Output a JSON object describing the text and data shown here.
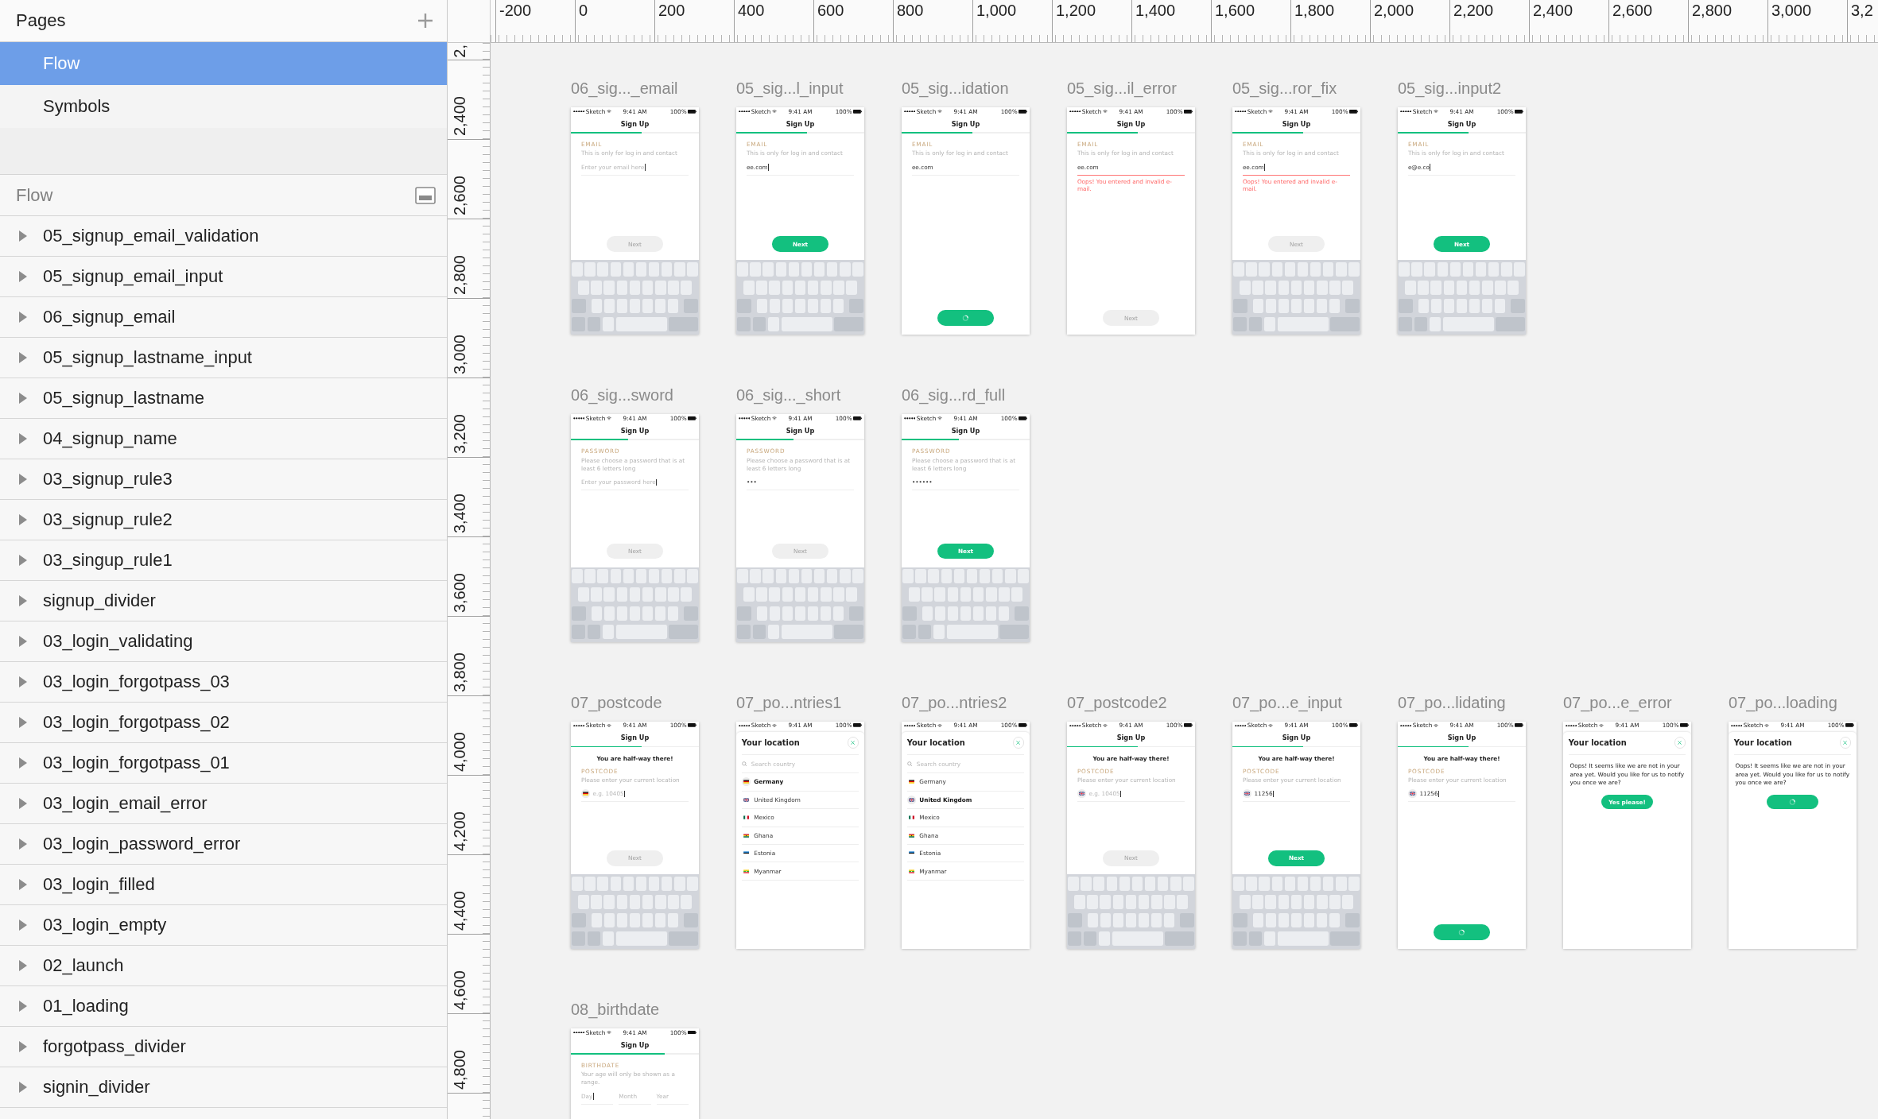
{
  "sidebar": {
    "pages_header": {
      "title": "Pages"
    },
    "pages": [
      {
        "label": "Flow",
        "selected": true
      },
      {
        "label": "Symbols",
        "selected": false
      }
    ],
    "layers_header": {
      "title": "Flow"
    },
    "layers": [
      {
        "name": "05_signup_email_validation",
        "expanded": false
      },
      {
        "name": "05_signup_email_input",
        "expanded": false
      },
      {
        "name": "06_signup_email",
        "expanded": false
      },
      {
        "name": "05_signup_lastname_input",
        "expanded": false
      },
      {
        "name": "05_signup_lastname",
        "expanded": false
      },
      {
        "name": "04_signup_name",
        "expanded": false
      },
      {
        "name": "03_signup_rule3",
        "expanded": false
      },
      {
        "name": "03_signup_rule2",
        "expanded": false
      },
      {
        "name": "03_singup_rule1",
        "expanded": false
      },
      {
        "name": "signup_divider",
        "expanded": false
      },
      {
        "name": "03_login_validating",
        "expanded": false
      },
      {
        "name": "03_login_forgotpass_03",
        "expanded": false
      },
      {
        "name": "03_login_forgotpass_02",
        "expanded": false
      },
      {
        "name": "03_login_forgotpass_01",
        "expanded": false
      },
      {
        "name": "03_login_email_error",
        "expanded": false
      },
      {
        "name": "03_login_password_error",
        "expanded": false
      },
      {
        "name": "03_login_filled",
        "expanded": false
      },
      {
        "name": "03_login_empty",
        "expanded": false
      },
      {
        "name": "02_launch",
        "expanded": false
      },
      {
        "name": "01_loading",
        "expanded": false
      },
      {
        "name": "forgotpass_divider",
        "expanded": false
      },
      {
        "name": "signin_divider",
        "expanded": false
      }
    ]
  },
  "rulers": {
    "horizontal": [
      "-200",
      "0",
      "200",
      "400",
      "600",
      "800",
      "1,000",
      "1,200",
      "1,400",
      "1,600",
      "1,800",
      "2,000",
      "2,200",
      "2,400",
      "2,600",
      "2,800",
      "3,000",
      "3,2"
    ],
    "vertical": [
      "2,",
      "2,400",
      "2,600",
      "2,800",
      "3,000",
      "3,200",
      "3,400",
      "3,600",
      "3,800",
      "4,000",
      "4,200",
      "4,400",
      "4,600",
      "4,800"
    ]
  },
  "canvas": {
    "rows": [
      {
        "artboards": [
          {
            "title": "06_sig..._email",
            "status_bar": {
              "carrier": "Sketch",
              "time": "9:41 AM",
              "battery": "100%"
            },
            "screen": {
              "kind": "signup",
              "title": "Sign Up",
              "progress": {
                "level": 0.55
              },
              "label": "EMAIL",
              "hint": "This is only for log in and contact",
              "fields": [
                {
                  "placeholder": "Enter your email here",
                  "cursor": true,
                  "error": false
                }
              ],
              "button": {
                "label": "Next",
                "enabled": false,
                "loading": false
              },
              "keyboard": true
            }
          },
          {
            "title": "05_sig...l_input",
            "status_bar": {
              "carrier": "Sketch",
              "time": "9:41 AM",
              "battery": "100%"
            },
            "screen": {
              "kind": "signup",
              "title": "Sign Up",
              "progress": {
                "level": 0.55
              },
              "label": "EMAIL",
              "hint": "This is only for log in and contact",
              "fields": [
                {
                  "value": "ee.com",
                  "cursor": true,
                  "error": false
                }
              ],
              "button": {
                "label": "Next",
                "enabled": true,
                "loading": false
              },
              "keyboard": true
            }
          },
          {
            "title": "05_sig...idation",
            "status_bar": {
              "carrier": "Sketch",
              "time": "9:41 AM",
              "battery": "100%"
            },
            "screen": {
              "kind": "signup",
              "title": "Sign Up",
              "progress": {
                "level": 0.55
              },
              "label": "EMAIL",
              "hint": "This is only for log in and contact",
              "fields": [
                {
                  "value": "ee.com",
                  "cursor": false,
                  "error": false
                }
              ],
              "button": {
                "enabled": true,
                "loading": true
              },
              "keyboard": false
            }
          },
          {
            "title": "05_sig...il_error",
            "status_bar": {
              "carrier": "Sketch",
              "time": "9:41 AM",
              "battery": "100%"
            },
            "screen": {
              "kind": "signup",
              "title": "Sign Up",
              "progress": {
                "level": 0.55
              },
              "label": "EMAIL",
              "hint": "This is only for log in and contact",
              "fields": [
                {
                  "value": "ee.com",
                  "cursor": false,
                  "error": true
                }
              ],
              "error_text": "Oops! You entered and invalid e-mail.",
              "button": {
                "label": "Next",
                "enabled": false,
                "loading": false
              },
              "keyboard": false
            }
          },
          {
            "title": "05_sig...ror_fix",
            "status_bar": {
              "carrier": "Sketch",
              "time": "9:41 AM",
              "battery": "100%"
            },
            "screen": {
              "kind": "signup",
              "title": "Sign Up",
              "progress": {
                "level": 0.55
              },
              "label": "EMAIL",
              "hint": "This is only for log in and contact",
              "fields": [
                {
                  "value": "ee.com",
                  "cursor": true,
                  "error": true
                }
              ],
              "error_text": "Oops! You entered and invalid e-mail.",
              "button": {
                "label": "Next",
                "enabled": false,
                "loading": false
              },
              "keyboard": true
            }
          },
          {
            "title": "05_sig...input2",
            "status_bar": {
              "carrier": "Sketch",
              "time": "9:41 AM",
              "battery": "100%"
            },
            "screen": {
              "kind": "signup",
              "title": "Sign Up",
              "progress": {
                "level": 0.55
              },
              "label": "EMAIL",
              "hint": "This is only for log in and contact",
              "fields": [
                {
                  "value": "e@e.co",
                  "cursor": true,
                  "error": false
                }
              ],
              "button": {
                "label": "Next",
                "enabled": true,
                "loading": false
              },
              "keyboard": true
            }
          }
        ]
      },
      {
        "artboards": [
          {
            "title": "06_sig...sword",
            "status_bar": {
              "carrier": "Sketch",
              "time": "9:41 AM",
              "battery": "100%"
            },
            "screen": {
              "kind": "signup",
              "title": "Sign Up",
              "progress": {
                "level": 0.45
              },
              "label": "PASSWORD",
              "hint": "Please choose a password that is at least 6 letters long",
              "fields": [
                {
                  "placeholder": "Enter your password here",
                  "cursor": true,
                  "error": false
                }
              ],
              "button": {
                "label": "Next",
                "enabled": false,
                "loading": false
              },
              "keyboard": true
            }
          },
          {
            "title": "06_sig..._short",
            "status_bar": {
              "carrier": "Sketch",
              "time": "9:41 AM",
              "battery": "100%"
            },
            "screen": {
              "kind": "signup",
              "title": "Sign Up",
              "progress": {
                "level": 0.45
              },
              "label": "PASSWORD",
              "hint": "Please choose a password that is at least 6 letters long",
              "fields": [
                {
                  "value": "•••",
                  "cursor": false,
                  "error": false
                }
              ],
              "button": {
                "label": "Next",
                "enabled": false,
                "loading": false
              },
              "keyboard": true
            }
          },
          {
            "title": "06_sig...rd_full",
            "status_bar": {
              "carrier": "Sketch",
              "time": "9:41 AM",
              "battery": "100%"
            },
            "screen": {
              "kind": "signup",
              "title": "Sign Up",
              "progress": {
                "level": 0.45
              },
              "label": "PASSWORD",
              "hint": "Please choose a password that is at least 6 letters long",
              "fields": [
                {
                  "value": "••••••",
                  "cursor": false,
                  "error": false
                }
              ],
              "button": {
                "label": "Next",
                "enabled": true,
                "loading": false
              },
              "keyboard": true
            }
          }
        ]
      },
      {
        "artboards": [
          {
            "title": "07_postcode",
            "status_bar": {
              "carrier": "Sketch",
              "time": "9:41 AM",
              "battery": "100%"
            },
            "screen": {
              "kind": "signup",
              "title": "Sign Up",
              "progress": {
                "level": 0.55
              },
              "heading": "You are half-way there!",
              "label": "POSTCODE",
              "hint": "Please enter your current location",
              "fields": [
                {
                  "flag": {
                    "kind": "de"
                  },
                  "placeholder": "e.g. 10405",
                  "cursor": true,
                  "error": false
                }
              ],
              "button": {
                "label": "Next",
                "enabled": false,
                "loading": false
              },
              "keyboard": true
            }
          },
          {
            "title": "07_po...ntries1",
            "status_bar": {
              "carrier": "Sketch",
              "time": "9:41 AM",
              "battery": "100%"
            },
            "screen": {
              "kind": "country_list",
              "title": "Your location",
              "search": {
                "placeholder": "Search country"
              },
              "countries": [
                {
                  "name": "Germany",
                  "flag": {
                    "kind": "de"
                  },
                  "selected": true
                },
                {
                  "name": "United Kingdom",
                  "flag": {
                    "kind": "gb"
                  },
                  "selected": false
                },
                {
                  "name": "Mexico",
                  "flag": {
                    "kind": "mx"
                  },
                  "selected": false
                },
                {
                  "name": "Ghana",
                  "flag": {
                    "kind": "gh"
                  },
                  "selected": false
                },
                {
                  "name": "Estonia",
                  "flag": {
                    "kind": "ee"
                  },
                  "selected": false
                },
                {
                  "name": "Myanmar",
                  "flag": {
                    "kind": "mm"
                  },
                  "selected": false
                }
              ]
            }
          },
          {
            "title": "07_po...ntries2",
            "status_bar": {
              "carrier": "Sketch",
              "time": "9:41 AM",
              "battery": "100%"
            },
            "screen": {
              "kind": "country_list",
              "title": "Your location",
              "search": {
                "placeholder": "Search country"
              },
              "countries": [
                {
                  "name": "Germany",
                  "flag": {
                    "kind": "de"
                  },
                  "selected": false
                },
                {
                  "name": "United Kingdom",
                  "flag": {
                    "kind": "gb"
                  },
                  "selected": true
                },
                {
                  "name": "Mexico",
                  "flag": {
                    "kind": "mx"
                  },
                  "selected": false
                },
                {
                  "name": "Ghana",
                  "flag": {
                    "kind": "gh"
                  },
                  "selected": false
                },
                {
                  "name": "Estonia",
                  "flag": {
                    "kind": "ee"
                  },
                  "selected": false
                },
                {
                  "name": "Myanmar",
                  "flag": {
                    "kind": "mm"
                  },
                  "selected": false
                }
              ]
            }
          },
          {
            "title": "07_postcode2",
            "status_bar": {
              "carrier": "Sketch",
              "time": "9:41 AM",
              "battery": "100%"
            },
            "screen": {
              "kind": "signup",
              "title": "Sign Up",
              "progress": {
                "level": 0.55
              },
              "heading": "You are half-way there!",
              "label": "POSTCODE",
              "hint": "Please enter your current location",
              "fields": [
                {
                  "flag": {
                    "kind": "gb"
                  },
                  "placeholder": "e.g. 10405",
                  "cursor": true,
                  "error": false
                }
              ],
              "button": {
                "label": "Next",
                "enabled": false,
                "loading": false
              },
              "keyboard": true
            }
          },
          {
            "title": "07_po...e_input",
            "status_bar": {
              "carrier": "Sketch",
              "time": "9:41 AM",
              "battery": "100%"
            },
            "screen": {
              "kind": "signup",
              "title": "Sign Up",
              "progress": {
                "level": 0.55
              },
              "heading": "You are half-way there!",
              "label": "POSTCODE",
              "hint": "Please enter your current location",
              "fields": [
                {
                  "flag": {
                    "kind": "gb"
                  },
                  "value": "11256",
                  "cursor": true,
                  "error": false
                }
              ],
              "button": {
                "label": "Next",
                "enabled": true,
                "loading": false
              },
              "keyboard": true
            }
          },
          {
            "title": "07_po...lidating",
            "status_bar": {
              "carrier": "Sketch",
              "time": "9:41 AM",
              "battery": "100%"
            },
            "screen": {
              "kind": "signup",
              "title": "Sign Up",
              "progress": {
                "level": 0.55
              },
              "heading": "You are half-way there!",
              "label": "POSTCODE",
              "hint": "Please enter your current location",
              "fields": [
                {
                  "flag": {
                    "kind": "gb"
                  },
                  "value": "11256",
                  "cursor": true,
                  "error": false
                }
              ],
              "button": {
                "enabled": true,
                "loading": true
              },
              "keyboard": false
            }
          },
          {
            "title": "07_po...e_error",
            "status_bar": {
              "carrier": "Sketch",
              "time": "9:41 AM",
              "battery": "100%"
            },
            "screen": {
              "kind": "message",
              "title": "Your location",
              "message": "Oops! It seems like we are not in your area yet. Would you like for us to notify you once we are?",
              "button": {
                "label": "Yes please!",
                "enabled": true,
                "loading": false
              }
            }
          },
          {
            "title": "07_po...loading",
            "status_bar": {
              "carrier": "Sketch",
              "time": "9:41 AM",
              "battery": "100%"
            },
            "screen": {
              "kind": "message",
              "title": "Your location",
              "message": "Oops! It seems like we are not in your area yet. Would you like for us to notify you once we are?",
              "button": {
                "enabled": true,
                "loading": true
              }
            }
          }
        ]
      },
      {
        "artboards": [
          {
            "title": "08_birthdate",
            "status_bar": {
              "carrier": "Sketch",
              "time": "9:41 AM",
              "battery": "100%"
            },
            "screen": {
              "kind": "signup",
              "title": "Sign Up",
              "progress": {
                "level": 0.73
              },
              "label": "BIRTHDATE",
              "hint": "Your age will only be shown as a range.",
              "fields": [
                {
                  "placeholder": "Day",
                  "cursor": true,
                  "error": false
                },
                {
                  "placeholder": "Month",
                  "cursor": false,
                  "error": false
                },
                {
                  "placeholder": "Year",
                  "cursor": false,
                  "error": false
                }
              ],
              "keyboard": false
            }
          }
        ]
      }
    ]
  }
}
